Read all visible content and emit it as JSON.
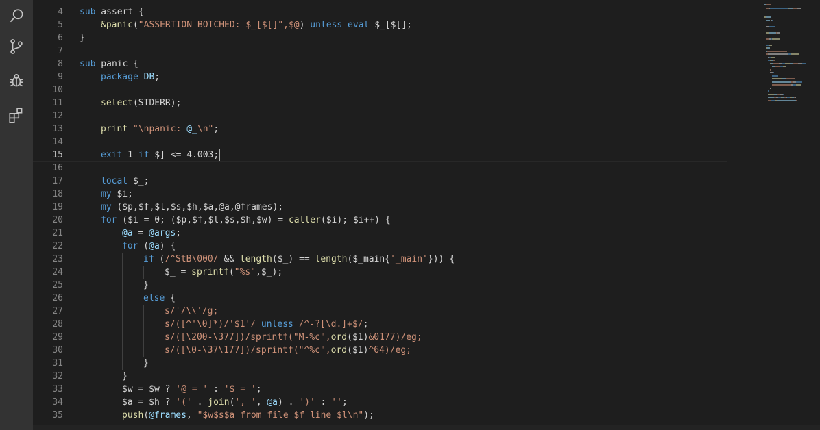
{
  "activity_bar": {
    "items": [
      {
        "name": "search-icon",
        "label": "Search"
      },
      {
        "name": "source-control-icon",
        "label": "Source Control"
      },
      {
        "name": "debug-icon",
        "label": "Run and Debug"
      },
      {
        "name": "extensions-icon",
        "label": "Extensions"
      }
    ]
  },
  "colors": {
    "keyword": "#569cd6",
    "function": "#dcdcaa",
    "string": "#ce9178",
    "variable": "#9cdcfe",
    "number": "#b5cea8",
    "default": "#d4d4d4",
    "operator": "#d4d4d4"
  },
  "editor": {
    "current_line": 15,
    "lines": [
      {
        "n": "4",
        "indent": 0,
        "tokens": [
          [
            "kw",
            "sub"
          ],
          [
            "pl",
            " assert {"
          ]
        ]
      },
      {
        "n": "5",
        "indent": 1,
        "tokens": [
          [
            "fn",
            "&panic"
          ],
          [
            "pl",
            "("
          ],
          [
            "st",
            "\"ASSERTION BOTCHED: $_[$[]\",$@"
          ],
          [
            "pl",
            ")"
          ],
          [
            "kw",
            " unless"
          ],
          [
            "kw",
            " eval"
          ],
          [
            "pl",
            " $_[$[];"
          ]
        ]
      },
      {
        "n": "6",
        "indent": 0,
        "tokens": [
          [
            "pl",
            "}"
          ]
        ]
      },
      {
        "n": "7",
        "indent": 0,
        "tokens": []
      },
      {
        "n": "8",
        "indent": 0,
        "tokens": [
          [
            "kw",
            "sub"
          ],
          [
            "pl",
            " panic {"
          ]
        ]
      },
      {
        "n": "9",
        "indent": 1,
        "tokens": [
          [
            "kw",
            "package"
          ],
          [
            "pl",
            " "
          ],
          [
            "va",
            "DB"
          ],
          [
            "pl",
            ";"
          ]
        ]
      },
      {
        "n": "10",
        "indent": 1,
        "tokens": []
      },
      {
        "n": "11",
        "indent": 1,
        "tokens": [
          [
            "fn",
            "select"
          ],
          [
            "pl",
            "(STDERR);"
          ]
        ]
      },
      {
        "n": "12",
        "indent": 1,
        "tokens": []
      },
      {
        "n": "13",
        "indent": 1,
        "tokens": [
          [
            "fn",
            "print"
          ],
          [
            "st",
            " \"\\npanic: "
          ],
          [
            "va",
            "@_"
          ],
          [
            "st",
            "\\n\""
          ],
          [
            "pl",
            ";"
          ]
        ]
      },
      {
        "n": "14",
        "indent": 1,
        "tokens": []
      },
      {
        "n": "15",
        "indent": 1,
        "tokens": [
          [
            "kw",
            "exit"
          ],
          [
            "pl",
            " 1 "
          ],
          [
            "kw",
            "if"
          ],
          [
            "pl",
            " $] <= 4.003;"
          ]
        ]
      },
      {
        "n": "16",
        "indent": 1,
        "tokens": []
      },
      {
        "n": "17",
        "indent": 1,
        "tokens": [
          [
            "kw",
            "local"
          ],
          [
            "pl",
            " $_;"
          ]
        ]
      },
      {
        "n": "18",
        "indent": 1,
        "tokens": [
          [
            "kw",
            "my"
          ],
          [
            "pl",
            " $i;"
          ]
        ]
      },
      {
        "n": "19",
        "indent": 1,
        "tokens": [
          [
            "kw",
            "my"
          ],
          [
            "pl",
            " ($p,$f,$l,$s,$h,$a,@a,@frames);"
          ]
        ]
      },
      {
        "n": "20",
        "indent": 1,
        "tokens": [
          [
            "kw",
            "for"
          ],
          [
            "pl",
            " ($i = 0; ($p,$f,$l,$s,$h,$w) = "
          ],
          [
            "fn",
            "caller"
          ],
          [
            "pl",
            "($i); $i++) {"
          ]
        ]
      },
      {
        "n": "21",
        "indent": 2,
        "tokens": [
          [
            "va",
            "@a"
          ],
          [
            "pl",
            " = "
          ],
          [
            "va",
            "@args"
          ],
          [
            "pl",
            ";"
          ]
        ]
      },
      {
        "n": "22",
        "indent": 2,
        "tokens": [
          [
            "kw",
            "for"
          ],
          [
            "pl",
            " ("
          ],
          [
            "va",
            "@a"
          ],
          [
            "pl",
            ") {"
          ]
        ]
      },
      {
        "n": "23",
        "indent": 3,
        "tokens": [
          [
            "kw",
            "if"
          ],
          [
            "pl",
            " ("
          ],
          [
            "st",
            "/^StB\\000/"
          ],
          [
            "pl",
            " && "
          ],
          [
            "fn",
            "length"
          ],
          [
            "pl",
            "($_) == "
          ],
          [
            "fn",
            "length"
          ],
          [
            "pl",
            "($_main{"
          ],
          [
            "st",
            "'_main'"
          ],
          [
            "pl",
            "})) {"
          ]
        ]
      },
      {
        "n": "24",
        "indent": 4,
        "tokens": [
          [
            "pl",
            "$_ = "
          ],
          [
            "fn",
            "sprintf"
          ],
          [
            "pl",
            "("
          ],
          [
            "st",
            "\"%s\""
          ],
          [
            "pl",
            ",$_);"
          ]
        ]
      },
      {
        "n": "25",
        "indent": 3,
        "tokens": [
          [
            "pl",
            "}"
          ]
        ]
      },
      {
        "n": "26",
        "indent": 3,
        "tokens": [
          [
            "kw",
            "else"
          ],
          [
            "pl",
            " {"
          ]
        ]
      },
      {
        "n": "27",
        "indent": 4,
        "tokens": [
          [
            "st",
            "s/'/\\\\'/g;"
          ]
        ]
      },
      {
        "n": "28",
        "indent": 4,
        "tokens": [
          [
            "st",
            "s/([^'\\0]*)/'$1'/"
          ],
          [
            "kw",
            " unless"
          ],
          [
            "st",
            " /^-?[\\d.]+$/"
          ],
          [
            "pl",
            ";"
          ]
        ]
      },
      {
        "n": "29",
        "indent": 4,
        "tokens": [
          [
            "st",
            "s/([\\200-\\377])/sprintf(\"M-%c\","
          ],
          [
            "fn",
            "ord"
          ],
          [
            "pl",
            "($1)"
          ],
          [
            "st",
            "&0177)/eg;"
          ]
        ]
      },
      {
        "n": "30",
        "indent": 4,
        "tokens": [
          [
            "st",
            "s/([\\0-\\37\\177])/sprintf(\"^%c\","
          ],
          [
            "fn",
            "ord"
          ],
          [
            "pl",
            "($1)"
          ],
          [
            "st",
            "^64)/eg;"
          ]
        ]
      },
      {
        "n": "31",
        "indent": 3,
        "tokens": [
          [
            "pl",
            "}"
          ]
        ]
      },
      {
        "n": "32",
        "indent": 2,
        "tokens": [
          [
            "pl",
            "}"
          ]
        ]
      },
      {
        "n": "33",
        "indent": 2,
        "tokens": [
          [
            "pl",
            "$w = $w ? "
          ],
          [
            "st",
            "'@ = '"
          ],
          [
            "pl",
            " : "
          ],
          [
            "st",
            "'$ = '"
          ],
          [
            "pl",
            ";"
          ]
        ]
      },
      {
        "n": "34",
        "indent": 2,
        "tokens": [
          [
            "pl",
            "$a = $h ? "
          ],
          [
            "st",
            "'('"
          ],
          [
            "pl",
            " . "
          ],
          [
            "fn",
            "join"
          ],
          [
            "pl",
            "("
          ],
          [
            "st",
            "', '"
          ],
          [
            "pl",
            ", "
          ],
          [
            "va",
            "@a"
          ],
          [
            "pl",
            ") . "
          ],
          [
            "st",
            "')'"
          ],
          [
            "pl",
            " : "
          ],
          [
            "st",
            "''"
          ],
          [
            "pl",
            ";"
          ]
        ]
      },
      {
        "n": "35",
        "indent": 2,
        "tokens": [
          [
            "fn",
            "push"
          ],
          [
            "pl",
            "("
          ],
          [
            "va",
            "@frames"
          ],
          [
            "pl",
            ", "
          ],
          [
            "st",
            "\"$w$s$a from file $f line $l\\n\""
          ],
          [
            "pl",
            ");"
          ]
        ]
      }
    ]
  }
}
